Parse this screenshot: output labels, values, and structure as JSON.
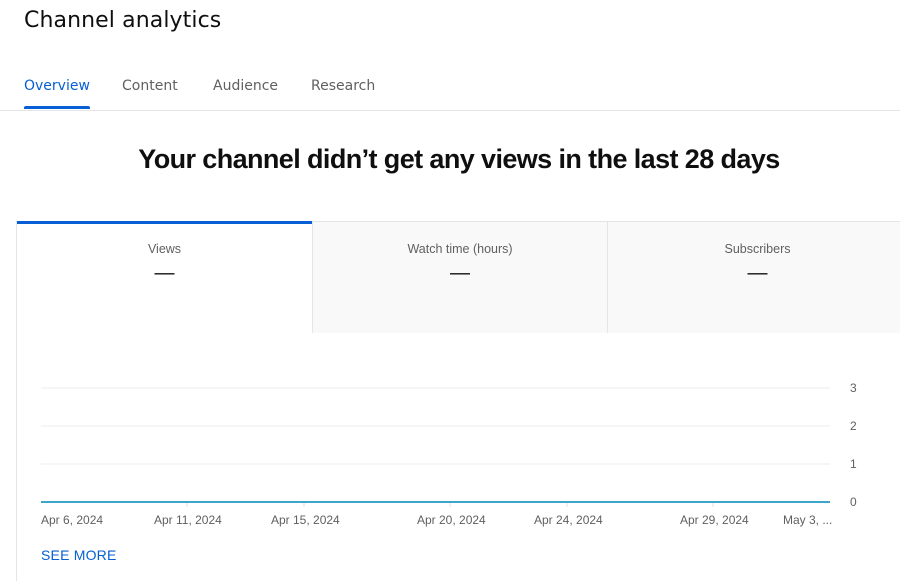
{
  "page": {
    "title": "Channel analytics",
    "tabs": [
      {
        "label": "Overview",
        "active": true
      },
      {
        "label": "Content",
        "active": false
      },
      {
        "label": "Audience",
        "active": false
      },
      {
        "label": "Research",
        "active": false
      }
    ],
    "headline": "Your channel didn’t get any views in the last 28 days"
  },
  "metrics": [
    {
      "label": "Views",
      "value": "—",
      "active": true
    },
    {
      "label": "Watch time (hours)",
      "value": "—",
      "active": false
    },
    {
      "label": "Subscribers",
      "value": "—",
      "active": false
    }
  ],
  "colors": {
    "accent": "#065fd4",
    "line": "#3ea6c9",
    "grid": "#eeeeee",
    "axis_text": "#606060"
  },
  "chart_data": {
    "type": "line",
    "title": "",
    "xlabel": "",
    "ylabel": "Views",
    "x_tick_labels": [
      "Apr 6, 2024",
      "Apr 11, 2024",
      "Apr 15, 2024",
      "Apr 20, 2024",
      "Apr 24, 2024",
      "Apr 29, 2024",
      "May 3, ..."
    ],
    "y_ticks": [
      0,
      1,
      2,
      3
    ],
    "ylim": [
      0,
      3
    ],
    "y_axis_position": "right",
    "grid": true,
    "series": [
      {
        "name": "Views",
        "x": [
          "Apr 6, 2024",
          "May 3, 2024"
        ],
        "values": [
          0,
          0
        ]
      }
    ]
  },
  "actions": {
    "see_more": "SEE MORE"
  }
}
